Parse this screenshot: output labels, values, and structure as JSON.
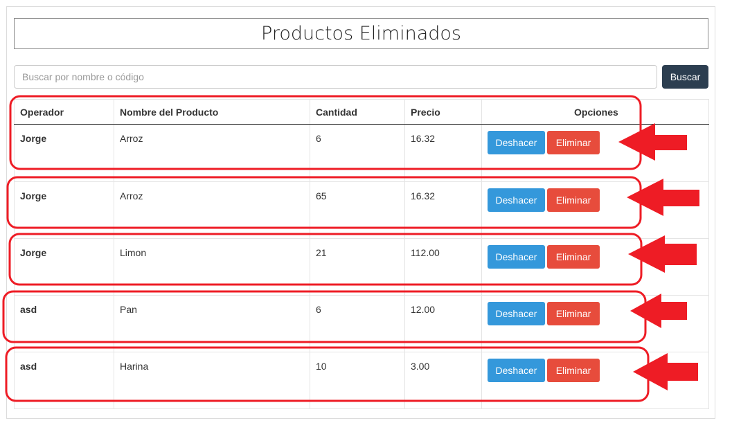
{
  "page": {
    "title": "Productos Eliminados"
  },
  "search": {
    "placeholder": "Buscar por nombre o código",
    "value": "",
    "button_label": "Buscar"
  },
  "table": {
    "headers": [
      "Operador",
      "Nombre del Producto",
      "Cantidad",
      "Precio",
      "Opciones"
    ],
    "undo_label": "Deshacer",
    "delete_label": "Eliminar",
    "rows": [
      {
        "operador": "Jorge",
        "producto": "Arroz",
        "cantidad": "6",
        "precio": "16.32"
      },
      {
        "operador": "Jorge",
        "producto": "Arroz",
        "cantidad": "65",
        "precio": "16.32"
      },
      {
        "operador": "Jorge",
        "producto": "Limon",
        "cantidad": "21",
        "precio": "112.00"
      },
      {
        "operador": "asd",
        "producto": "Pan",
        "cantidad": "6",
        "precio": "12.00"
      },
      {
        "operador": "asd",
        "producto": "Harina",
        "cantidad": "10",
        "precio": "3.00"
      }
    ]
  },
  "colors": {
    "annotation_red": "#ee1c25",
    "undo_button": "#3498db",
    "delete_button": "#e74c3c",
    "search_button": "#2c3e50"
  },
  "icons": {
    "annotation_arrow": "arrow-left-icon",
    "annotation_highlight": "highlight-outline"
  }
}
